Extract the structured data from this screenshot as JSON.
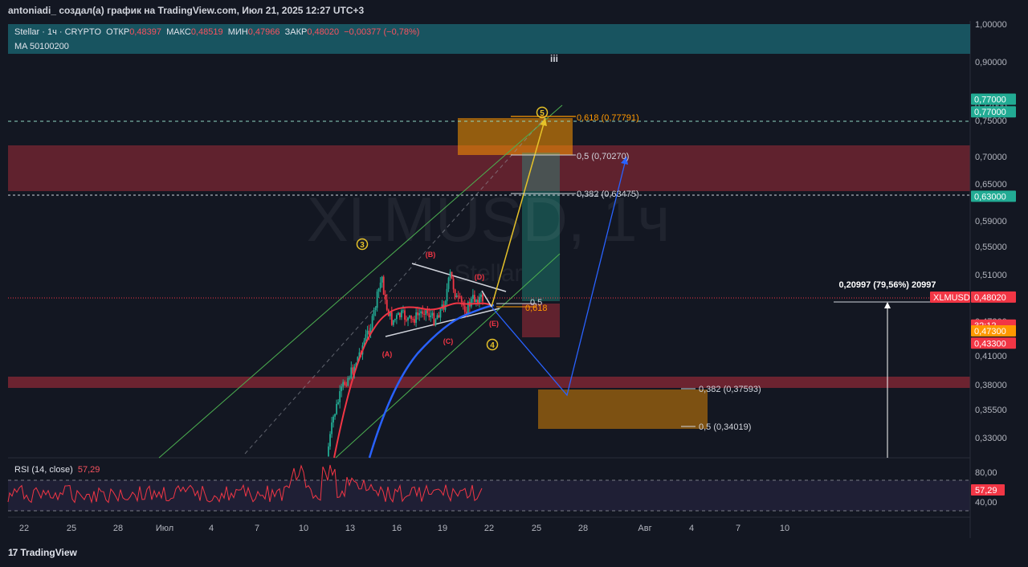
{
  "header": {
    "attribution": "antoniadi_ создал(а) график на TradingView.com, Июл 21, 2025 12:27 UTC+3"
  },
  "legend": {
    "symbol": "Stellar · 1ч · CRYPTO",
    "open_label": "ОТКР",
    "open": "0,48397",
    "high_label": "МАКС",
    "high": "0,48519",
    "low_label": "МИН",
    "low": "0,47966",
    "close_label": "ЗАКР",
    "close": "0,48020",
    "change": "−0,00377 (−0,78%)",
    "ma": "MA 50100200"
  },
  "watermark": {
    "ticker": "XLMUSD, 1ч",
    "name": "Stellar"
  },
  "rsi": {
    "label": "RSI (14, close)",
    "value": "57,29"
  },
  "footer": {
    "brand": "TradingView",
    "mark": "17"
  },
  "chart_data": {
    "type": "candlestick",
    "symbol": "XLMUSD",
    "interval": "1ч",
    "price_axis": {
      "ticks": [
        "1,00000",
        "0,90000",
        "0,77000",
        "0,75000",
        "0,70000",
        "0,65000",
        "0,59000",
        "0,55000",
        "0,51000",
        "0,47300",
        "0,41000",
        "0,38000",
        "0,35500",
        "0,33000"
      ],
      "labels": [
        {
          "text": "0,77000",
          "price": 0.79,
          "bg": "#22ab94"
        },
        {
          "text": "0,77000",
          "price": 0.762,
          "bg": "#22ab94"
        },
        {
          "text": "0,63000",
          "price": 0.63,
          "bg": "#22ab94"
        },
        {
          "text": "XLMUSD",
          "price": 0.4802,
          "bg": "#f23645"
        },
        {
          "text": "0,48020",
          "price": 0.4802,
          "bg": "#f23645"
        },
        {
          "text": "32:12",
          "price": 0.466,
          "bg": "#f23645"
        },
        {
          "text": "0,47300",
          "price": 0.4555,
          "bg": "#ff9800"
        },
        {
          "text": "0,43300",
          "price": 0.433,
          "bg": "#f23645"
        }
      ]
    },
    "time_axis": {
      "ticks": [
        "22",
        "25",
        "28",
        "Июл",
        "4",
        "7",
        "10",
        "13",
        "16",
        "19",
        "22",
        "25",
        "28",
        "Авг",
        "4",
        "7",
        "10"
      ]
    },
    "fib_labels": [
      {
        "text": "0,618 (0,77791)",
        "color": "#ff9800"
      },
      {
        "text": "0,5 (0,70270)",
        "color": "#d1d4dc"
      },
      {
        "text": "0,382 (0,63475)",
        "color": "#d1d4dc"
      },
      {
        "text": "0,382 (0,37593)",
        "color": "#d1d4dc"
      },
      {
        "text": "0,5 (0,34019)",
        "color": "#d1d4dc"
      },
      {
        "text": "0,5",
        "color": "#d1d4dc"
      },
      {
        "text": "0,618",
        "color": "#ff9800"
      }
    ],
    "wave_labels": [
      {
        "text": "3",
        "color": "#e6c229",
        "circled": true
      },
      {
        "text": "4",
        "color": "#e6c229",
        "circled": true
      },
      {
        "text": "5",
        "color": "#e6c229",
        "circled": true
      },
      {
        "text": "iii",
        "color": "#d1d4dc",
        "circled": false
      },
      {
        "text": "(A)",
        "color": "#f23645",
        "circled": false
      },
      {
        "text": "(B)",
        "color": "#f23645",
        "circled": false
      },
      {
        "text": "(C)",
        "color": "#f23645",
        "circled": false
      },
      {
        "text": "(D)",
        "color": "#f23645",
        "circled": false
      },
      {
        "text": "(E)",
        "color": "#f23645",
        "circled": false
      }
    ],
    "measure": {
      "text": "0,20997 (79,56%) 20997"
    },
    "rsi_axis": {
      "ticks": [
        "80,00",
        "40,00"
      ],
      "current": "57,29"
    },
    "colors": {
      "background": "#131722",
      "bull": "#22ab94",
      "bear": "#f23645",
      "ma50": "#f23645",
      "ma100": "#2962ff",
      "wave5_path": "#e6c229",
      "alt_path": "#2962ff",
      "channel": "#4caf50",
      "rsi": "#f23645"
    }
  }
}
